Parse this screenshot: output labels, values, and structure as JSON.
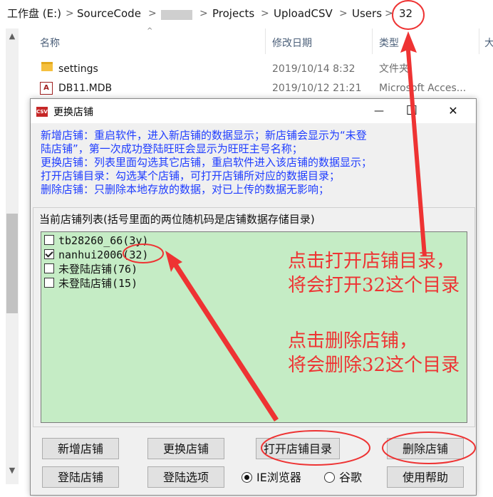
{
  "breadcrumb": {
    "items": [
      "工作盘 (E:)",
      "SourceCode",
      "Projects",
      "UploadCSV",
      "Users",
      "32"
    ],
    "separator": ">"
  },
  "columns": {
    "name": "名称",
    "date": "修改日期",
    "type": "类型"
  },
  "files": [
    {
      "name": "settings",
      "date": "2019/10/14 8:32",
      "type": "文件夹",
      "icon": "folder-icon"
    },
    {
      "name": "DB11.MDB",
      "date": "2019/10/12 21:21",
      "type": "Microsoft Acces...",
      "icon": "access-db-icon"
    }
  ],
  "dialog": {
    "title": "更换店铺",
    "icon_label": "CSV",
    "controls": {
      "minimize": "—",
      "maximize": "☐",
      "close": "✕"
    },
    "info_lines": [
      "新增店铺：重启软件，进入新店铺的数据显示；新店铺会显示为“未登",
      "陆店铺”，第一次成功登陆旺旺会显示为旺旺主号名称；",
      "更换店铺：列表里面勾选其它店铺，重启软件进入该店铺的数据显示；",
      "打开店铺目录：勾选某个店铺，可打开店铺所对应的数据目录；",
      "删除店铺：只删除本地存放的数据，对已上传的数据无影响；"
    ],
    "list_label": "当前店铺列表(括号里面的两位随机码是店铺数据存储目录)",
    "stores": [
      {
        "label": "tb28260_66(3y)",
        "checked": false
      },
      {
        "label": "nanhui2006(32)",
        "checked": true
      },
      {
        "label": "未登陆店铺(76)",
        "checked": false
      },
      {
        "label": "未登陆店铺(15)",
        "checked": false
      }
    ],
    "buttons": {
      "add": "新增店铺",
      "switch": "更换店铺",
      "open_dir": "打开店铺目录",
      "delete": "删除店铺",
      "login": "登陆店铺",
      "login_options": "登陆选项",
      "help": "使用帮助"
    },
    "browser_options": [
      {
        "label": "IE浏览器",
        "selected": true
      },
      {
        "label": "谷歌",
        "selected": false
      }
    ]
  },
  "annotations": {
    "open_note": [
      "点击打开店铺目录，",
      "将会打开32这个目录"
    ],
    "delete_note": [
      "点击删除店铺，",
      "将会删除32这个目录"
    ],
    "color": "#ee3333"
  },
  "colors": {
    "list_bg": "#c5ecc5",
    "info_text": "#1f3dff",
    "dialog_bg": "#f0f0f0"
  }
}
